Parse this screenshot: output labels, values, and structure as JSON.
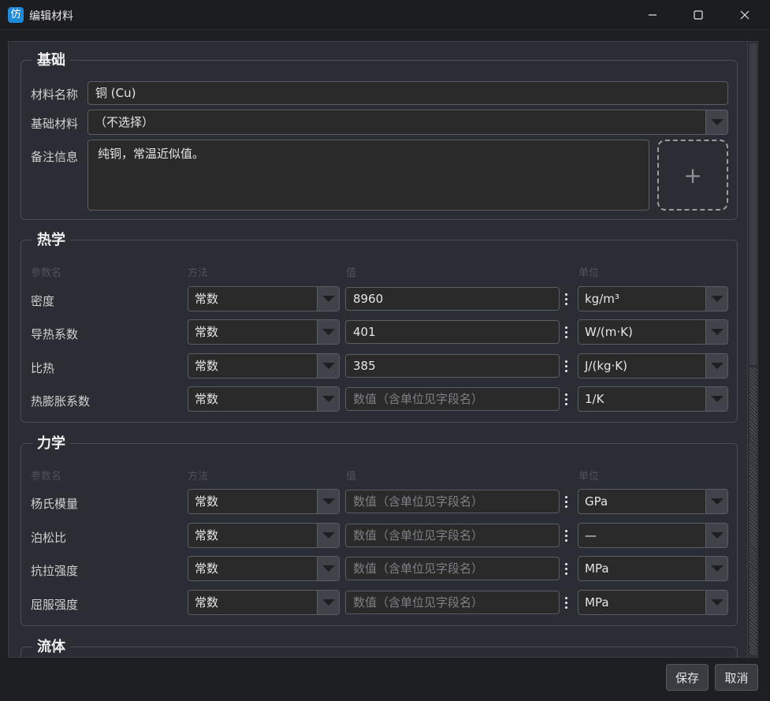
{
  "window": {
    "icon": "仿",
    "title": "编辑材料"
  },
  "basic": {
    "title": "基础",
    "name_label": "材料名称",
    "name_value": "铜 (Cu)",
    "base_label": "基础材料",
    "base_value": "（不选择）",
    "note_label": "备注信息",
    "note_value": "纯铜，常温近似值。",
    "image_slot": "+"
  },
  "thermal": {
    "title": "热学",
    "headers": [
      "参数名",
      "方法",
      "值",
      "单位"
    ],
    "rows": [
      {
        "label": "密度",
        "method": "常数",
        "value": "8960",
        "unit": "kg/m³"
      },
      {
        "label": "导热系数",
        "method": "常数",
        "value": "401",
        "unit": "W/(m·K)"
      },
      {
        "label": "比热",
        "method": "常数",
        "value": "385",
        "unit": "J/(kg·K)"
      },
      {
        "label": "热膨胀系数",
        "method": "常数",
        "placeholder": "数值（含单位见字段名）",
        "unit": "1/K"
      }
    ]
  },
  "mechanics": {
    "title": "力学",
    "headers": [
      "参数名",
      "方法",
      "值",
      "单位"
    ],
    "rows": [
      {
        "label": "杨氏模量",
        "method": "常数",
        "placeholder": "数值（含单位见字段名）",
        "unit": "GPa"
      },
      {
        "label": "泊松比",
        "method": "常数",
        "placeholder": "数值（含单位见字段名）",
        "unit": "—"
      },
      {
        "label": "抗拉强度",
        "method": "常数",
        "placeholder": "数值（含单位见字段名）",
        "unit": "MPa"
      },
      {
        "label": "屈服强度",
        "method": "常数",
        "placeholder": "数值（含单位见字段名）",
        "unit": "MPa"
      }
    ]
  },
  "fluid": {
    "title": "流体"
  },
  "footer": {
    "save": "保存",
    "cancel": "取消"
  },
  "icons": {
    "minimize": "minimize-icon",
    "maximize": "maximize-icon",
    "close": "close-icon"
  }
}
